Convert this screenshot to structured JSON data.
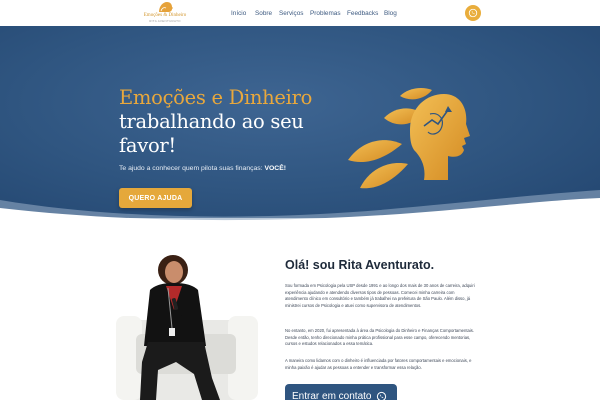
{
  "nav": {
    "logo_name": "Emoções & Dinheiro",
    "logo_tag": "RITA AVENTURATO",
    "items": [
      {
        "label": "Início"
      },
      {
        "label": "Sobre"
      },
      {
        "label": "Serviços"
      },
      {
        "label": "Problemas"
      },
      {
        "label": "Feedbacks"
      },
      {
        "label": "Blog"
      }
    ],
    "whatsapp_icon": "whatsapp-icon"
  },
  "hero": {
    "title_line1": "Emoções e Dinheiro",
    "title_line2": "trabalhando ao seu",
    "title_line3": "favor!",
    "subtitle": "Te ajudo a conhecer quem pilota suas finanças: ",
    "subtitle_emphasis": "VOCÊ!",
    "cta_label": "QUERO AJUDA",
    "colors": {
      "accent": "#e5a83b",
      "background": "#2f5580",
      "text": "#ffffff"
    }
  },
  "about": {
    "title": "Olá! sou Rita Aventurato.",
    "paragraphs": [
      "Sou formada em Psicologia pela USP desde 1991 e ao longo dos mais de 30 anos de carreira, adquiri experiência ajudando e atendendo diversos tipos de pessoas. Comecei minha carreira com atendimento clínico em consultório e também já trabalhei na prefeitura de São Paulo. Além disso, já ministrei cursos de Psicologia e atuei como supervisora de atendimentos.",
      "No entanto, em 2020, fui apresentada à área da Psicologia do Dinheiro e Finanças Comportamentais. Desde então, tenho direcionado minha prática profissional para esse campo, oferecendo mentorias, cursos e estudos relacionados a essa temática.",
      "A maneira como lidamos com o dinheiro é influenciada por fatores comportamentais e emocionais, e minha paixão é ajudar as pessoas a entender e transformar essa relação."
    ],
    "contact_label": "Entrar em contato",
    "contact_icon": "whatsapp-icon"
  }
}
